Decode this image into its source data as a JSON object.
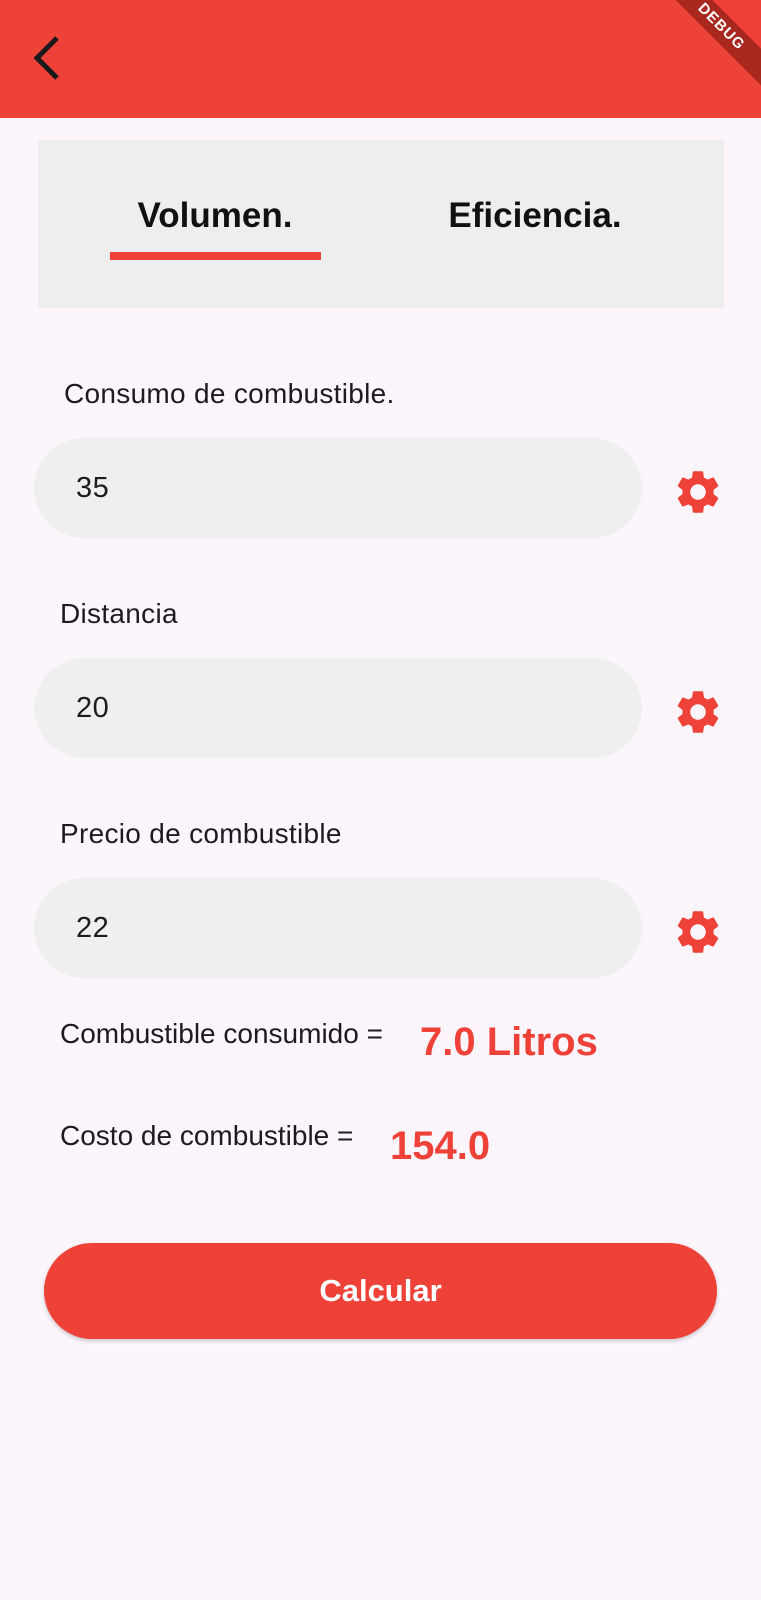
{
  "colors": {
    "accent": "#ee4238",
    "background": "#fcf6fc",
    "field_bg": "#efefef",
    "tabbar_bg": "#eeeeee"
  },
  "appbar": {
    "back_icon": "chevron-left-icon",
    "debug_banner": "DEBUG"
  },
  "tabs": [
    {
      "label": "Volumen.",
      "selected": true
    },
    {
      "label": "Eficiencia.",
      "selected": false
    }
  ],
  "fields": [
    {
      "label": "Consumo de combustible.",
      "value": "35",
      "icon": "gear-icon"
    },
    {
      "label": "Distancia",
      "value": "20",
      "icon": "gear-icon"
    },
    {
      "label": "Precio de combustible",
      "value": "22",
      "icon": "gear-icon"
    }
  ],
  "results": {
    "consumed_label": "Combustible consumido =",
    "consumed_value": "7.0 Litros",
    "cost_label": "Costo de combustible =",
    "cost_value": "154.0"
  },
  "actions": {
    "calculate_label": "Calcular"
  }
}
